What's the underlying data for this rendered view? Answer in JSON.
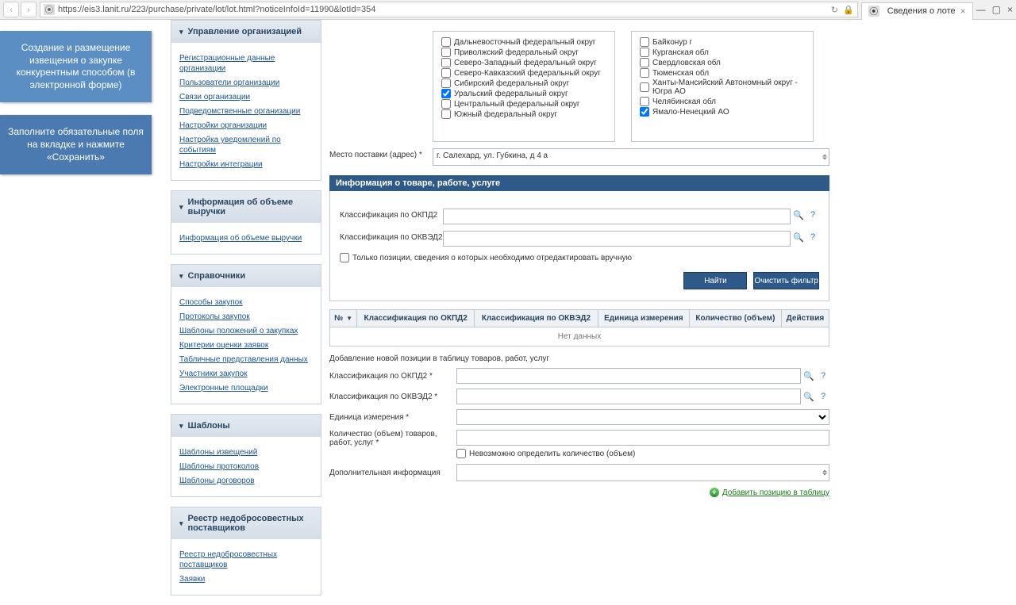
{
  "browser": {
    "url": "https://eis3.lanit.ru/223/purchase/private/lot/lot.html?noticeInfoId=11990&lotId=354",
    "tab_title": "Сведения о лоте"
  },
  "banners": {
    "banner1": "Создание и размещение извещения о закупке конкурентным способом (в электронной форме)",
    "banner2": "Заполните обязательные поля на вкладке и нажмите «Сохранить»"
  },
  "sidebar": {
    "sec1": {
      "title": "Управление организацией",
      "links": [
        "Регистрационные данные организации",
        "Пользователи организации",
        "Связи организации",
        "Подведомственные организации",
        "Настройки организации",
        "Настройка уведомлений по событиям",
        "Настройки интеграции"
      ]
    },
    "sec2": {
      "title": "Информация об объеме выручки",
      "links": [
        "Информация об объеме выручки"
      ]
    },
    "sec3": {
      "title": "Справочники",
      "links": [
        "Способы закупок",
        "Протоколы закупок",
        "Шаблоны положений о закупках",
        "Критерии оценки заявок",
        "Табличные представления данных",
        "Участники закупок",
        "Электронные площадки"
      ]
    },
    "sec4": {
      "title": "Шаблоны",
      "links": [
        "Шаблоны извещений",
        "Шаблоны протоколов",
        "Шаблоны договоров"
      ]
    },
    "sec5": {
      "title": "Реестр недобросовестных поставщиков",
      "links": [
        "Реестр недобросовестных поставщиков",
        "Заявки"
      ]
    }
  },
  "regions_left": [
    {
      "label": "Дальневосточный федеральный округ",
      "checked": false
    },
    {
      "label": "Приволжский федеральный округ",
      "checked": false
    },
    {
      "label": "Северо-Западный федеральный округ",
      "checked": false
    },
    {
      "label": "Северо-Кавказский федеральный округ",
      "checked": false
    },
    {
      "label": "Сибирский федеральный округ",
      "checked": false
    },
    {
      "label": "Уральский федеральный округ",
      "checked": true
    },
    {
      "label": "Центральный федеральный округ",
      "checked": false
    },
    {
      "label": "Южный федеральный округ",
      "checked": false
    }
  ],
  "regions_right": [
    {
      "label": "Байконур г",
      "checked": false
    },
    {
      "label": "Курганская обл",
      "checked": false
    },
    {
      "label": "Свердловская обл",
      "checked": false
    },
    {
      "label": "Тюменская обл",
      "checked": false
    },
    {
      "label": "Ханты-Мансийский Автономный округ - Югра АО",
      "checked": false
    },
    {
      "label": "Челябинская обл",
      "checked": false
    },
    {
      "label": "Ямало-Ненецкий АО",
      "checked": true
    }
  ],
  "delivery": {
    "label": "Место поставки (адрес) *",
    "value": "г. Салехард, ул. Губкина, д 4 а"
  },
  "section2": {
    "title": "Информация о товаре, работе, услуге",
    "okpd2_label": "Классификация по ОКПД2",
    "okved2_label": "Классификация по ОКВЭД2",
    "only_edit": "Только позиции, сведения о которых необходимо отредактировать вручную",
    "btn_search": "Найти",
    "btn_clear": "Очистить фильтр"
  },
  "table": {
    "cols": [
      "№",
      "Классификация по ОКПД2",
      "Классификация по ОКВЭД2",
      "Единица измерения",
      "Количество (объем)",
      "Действия"
    ],
    "empty": "Нет данных"
  },
  "add_form": {
    "title": "Добавление новой позиции в таблицу товаров, работ, услуг",
    "okpd2": "Классификация по ОКПД2 *",
    "okved2": "Классификация по ОКВЭД2 *",
    "unit": "Единица измерения *",
    "qty": "Количество (объем) товаров, работ, услуг *",
    "qty_impossible": "Невозможно определить количество (объем)",
    "extra": "Дополнительная информация",
    "add_link": "Добавить позицию в таблицу"
  }
}
